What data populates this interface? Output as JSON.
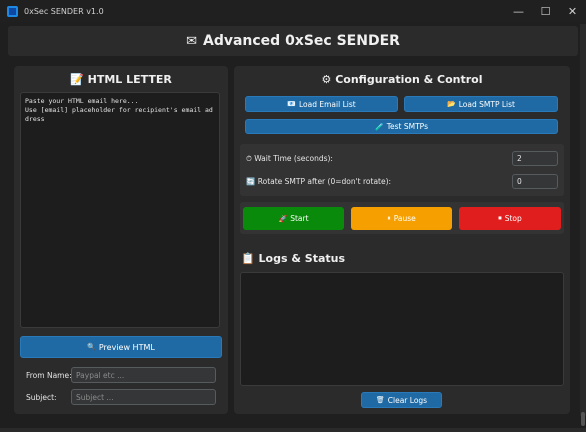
{
  "window": {
    "title": "0xSec SENDER v1.0",
    "minimize": "—",
    "maximize": "☐",
    "close": "✕"
  },
  "header": {
    "icon": "envelope-icon",
    "title": "Advanced 0xSec SENDER"
  },
  "letter": {
    "title": "HTML LETTER",
    "content": "Paste your HTML email here...\nUse [email] placeholder for recipient's email address",
    "preview_label": "Preview HTML",
    "from_label": "From Name:",
    "from_placeholder": "Paypal etc ...",
    "subject_label": "Subject:",
    "subject_placeholder": "Subject ..."
  },
  "config": {
    "title": "Configuration & Control",
    "load_email_label": "Load Email List",
    "load_smtp_label": "Load SMTP List",
    "test_smtp_label": "Test SMTPs",
    "wait_label": "Wait Time (seconds):",
    "wait_value": "2",
    "rotate_label": "Rotate SMTP after (0=don't rotate):",
    "rotate_value": "0",
    "start_label": "Start",
    "pause_label": "Pause",
    "stop_label": "Stop"
  },
  "logs": {
    "title": "Logs & Status",
    "clear_label": "Clear Logs"
  },
  "colors": {
    "accent_blue": "#1f6aa5",
    "start_green": "#0a8a0a",
    "pause_orange": "#f5a000",
    "stop_red": "#e01e1e"
  }
}
